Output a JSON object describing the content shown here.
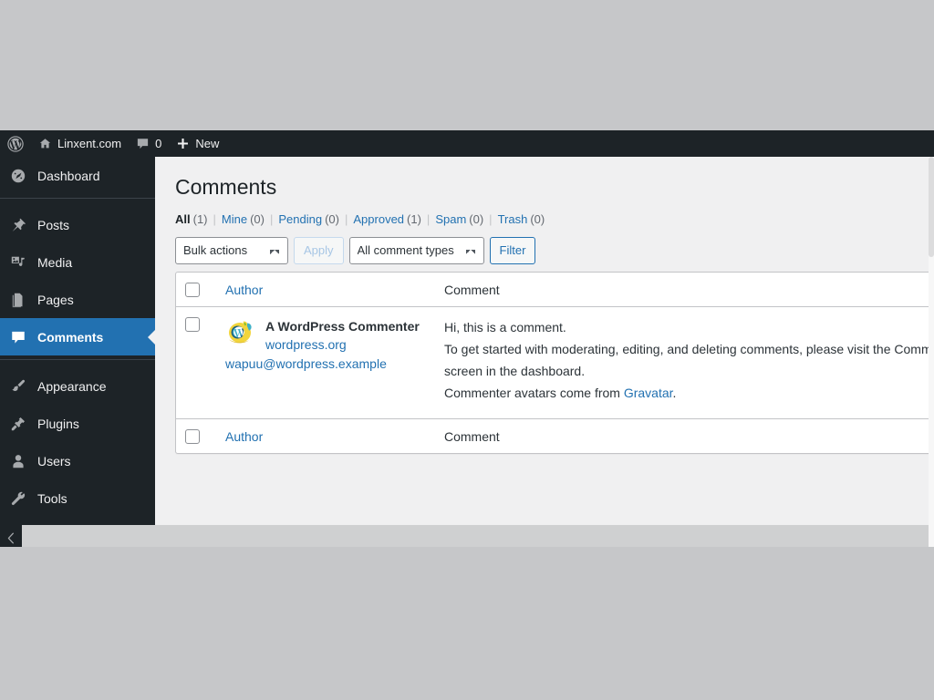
{
  "colors": {
    "admin_dark": "#1d2327",
    "accent_blue": "#2271b1",
    "page_bg": "#f0f0f1",
    "desktop_bg": "#c6c7c9",
    "link": "#2271b1",
    "text": "#2c3338"
  },
  "adminbar": {
    "logo_icon": "wordpress-logo-icon",
    "site_icon": "home-icon",
    "site_name": "Linxent.com",
    "comments_icon": "comment-bubble-icon",
    "comments_count": "0",
    "new_icon": "plus-icon",
    "new_label": "New"
  },
  "sidebar": {
    "items": [
      {
        "label": "Dashboard",
        "icon": "dashboard-gauge-icon",
        "current": false
      },
      {
        "label": "Posts",
        "icon": "pin-icon",
        "current": false
      },
      {
        "label": "Media",
        "icon": "media-icon",
        "current": false
      },
      {
        "label": "Pages",
        "icon": "pages-icon",
        "current": false
      },
      {
        "label": "Comments",
        "icon": "comment-bubble-icon",
        "current": true
      },
      {
        "label": "Appearance",
        "icon": "paintbrush-icon",
        "current": false
      },
      {
        "label": "Plugins",
        "icon": "plug-icon",
        "current": false
      },
      {
        "label": "Users",
        "icon": "user-icon",
        "current": false
      },
      {
        "label": "Tools",
        "icon": "wrench-icon",
        "current": false
      }
    ],
    "collapse_icon": "chevron-left-icon"
  },
  "main": {
    "title": "Comments",
    "filters": [
      {
        "label": "All",
        "count": "(1)",
        "current": true
      },
      {
        "label": "Mine",
        "count": "(0)",
        "current": false
      },
      {
        "label": "Pending",
        "count": "(0)",
        "current": false
      },
      {
        "label": "Approved",
        "count": "(1)",
        "current": false
      },
      {
        "label": "Spam",
        "count": "(0)",
        "current": false
      },
      {
        "label": "Trash",
        "count": "(0)",
        "current": false
      }
    ],
    "filter_divider": "|",
    "tablenav": {
      "bulk_actions_value": "Bulk actions",
      "apply_label": "Apply",
      "comment_types_value": "All comment types",
      "filter_label": "Filter"
    },
    "table": {
      "columns": {
        "author": "Author",
        "comment": "Comment"
      },
      "rows": [
        {
          "avatar_icon": "wapuu-avatar-icon",
          "author_name": "A WordPress Commenter",
          "author_url": "wordpress.org",
          "author_email": "wapuu@wordpress.example",
          "comment_line1": "Hi, this is a comment.",
          "comment_line2": "To get started with moderating, editing, and deleting comments, please visit the Comments",
          "comment_line3": "screen in the dashboard.",
          "comment_line4_pre": "Commenter avatars come from ",
          "comment_line4_link": "Gravatar",
          "comment_line4_post": "."
        }
      ]
    }
  }
}
